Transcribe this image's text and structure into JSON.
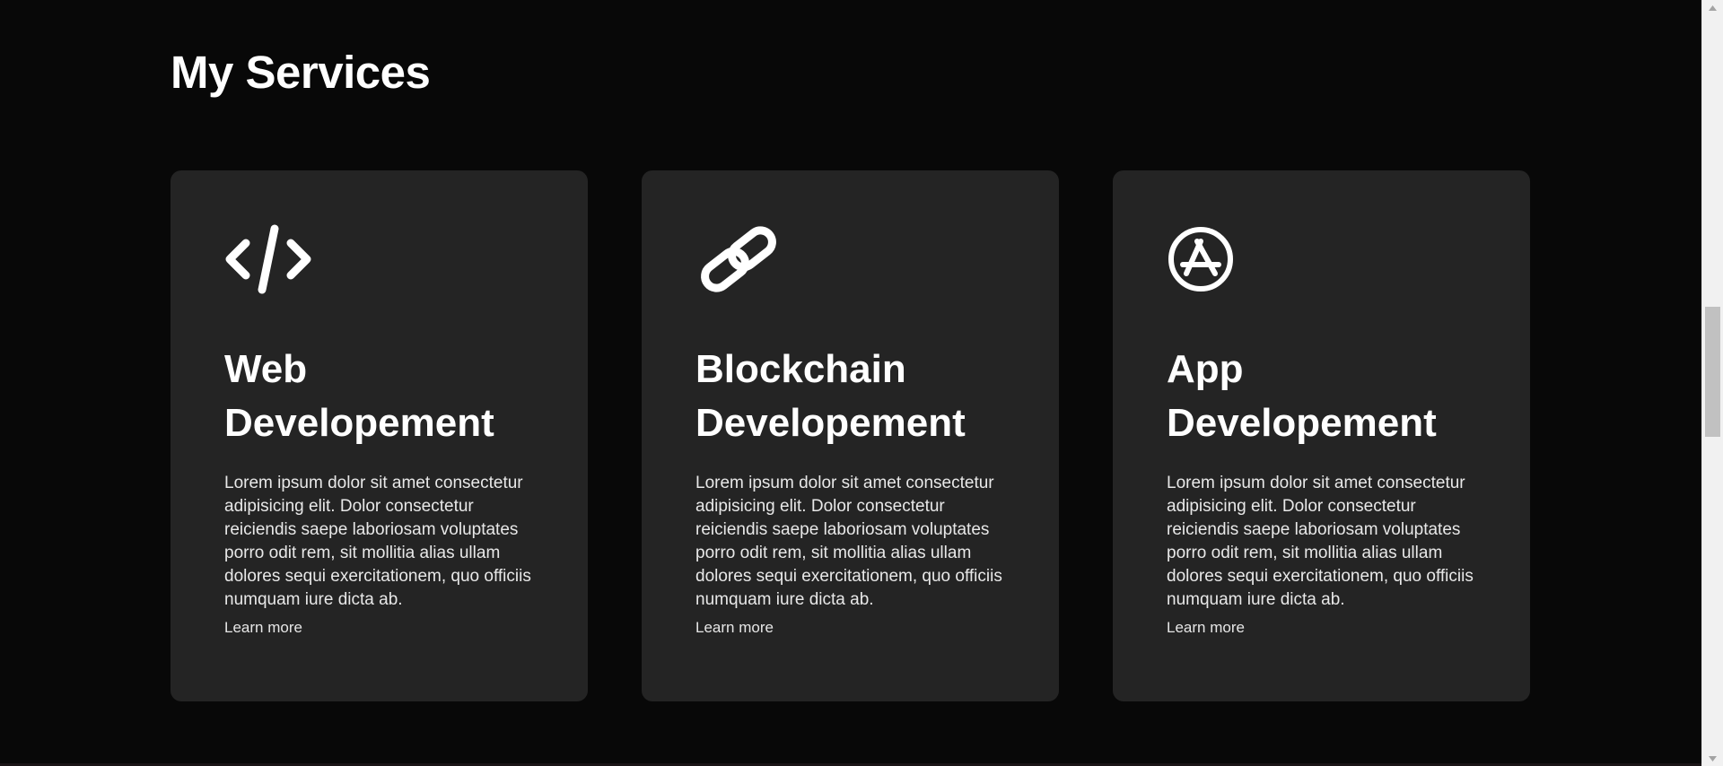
{
  "section": {
    "title": "My Services"
  },
  "cards": [
    {
      "icon": "code-icon",
      "title_line1": "Web",
      "title_line2": "Developement",
      "description": "Lorem ipsum dolor sit amet consectetur adipisicing elit. Dolor consectetur reiciendis saepe laboriosam voluptates porro odit rem, sit mollitia alias ullam dolores sequi exercitationem, quo officiis numquam iure dicta ab.",
      "link": "Learn more"
    },
    {
      "icon": "chain-link-icon",
      "title_line1": "Blockchain",
      "title_line2": "Developement",
      "description": "Lorem ipsum dolor sit amet consectetur adipisicing elit. Dolor consectetur reiciendis saepe laboriosam voluptates porro odit rem, sit mollitia alias ullam dolores sequi exercitationem, quo officiis numquam iure dicta ab.",
      "link": "Learn more"
    },
    {
      "icon": "app-store-icon",
      "title_line1": "App",
      "title_line2": "Developement",
      "description": "Lorem ipsum dolor sit amet consectetur adipisicing elit. Dolor consectetur reiciendis saepe laboriosam voluptates porro odit rem, sit mollitia alias ullam dolores sequi exercitationem, quo officiis numquam iure dicta ab.",
      "link": "Learn more"
    }
  ],
  "colors": {
    "background": "#080808",
    "card": "#242424",
    "text": "#ffffff"
  }
}
